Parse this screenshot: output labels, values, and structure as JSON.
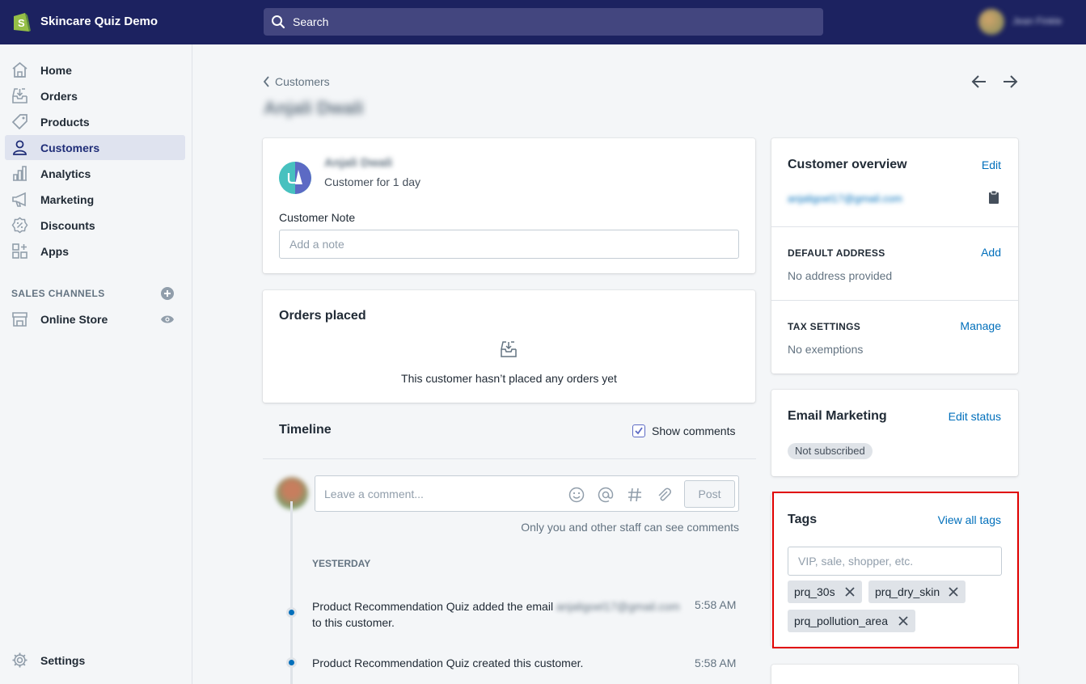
{
  "topbar": {
    "store_name": "Skincare Quiz Demo",
    "search_placeholder": "Search",
    "user_name": "Jean Finkle"
  },
  "sidebar": {
    "items": [
      {
        "label": "Home",
        "icon": "home-icon"
      },
      {
        "label": "Orders",
        "icon": "orders-icon"
      },
      {
        "label": "Products",
        "icon": "tag-icon"
      },
      {
        "label": "Customers",
        "icon": "person-icon",
        "active": true
      },
      {
        "label": "Analytics",
        "icon": "bar-chart-icon"
      },
      {
        "label": "Marketing",
        "icon": "megaphone-icon"
      },
      {
        "label": "Discounts",
        "icon": "discount-icon"
      },
      {
        "label": "Apps",
        "icon": "apps-icon"
      }
    ],
    "sales_channels_title": "SALES CHANNELS",
    "online_store": "Online Store",
    "settings": "Settings"
  },
  "breadcrumb": {
    "back_label": "Customers"
  },
  "page_title": "Anjali Dwali",
  "customer_card": {
    "name": "Anjali Dwali",
    "since": "Customer for 1 day",
    "note_label": "Customer Note",
    "note_placeholder": "Add a note"
  },
  "orders": {
    "title": "Orders placed",
    "empty_text": "This customer hasn’t placed any orders yet"
  },
  "timeline": {
    "title": "Timeline",
    "show_comments_label": "Show comments",
    "show_comments_checked": true,
    "comment_placeholder": "Leave a comment...",
    "post_label": "Post",
    "staff_note": "Only you and other staff can see comments",
    "day_label": "YESTERDAY",
    "events": [
      {
        "text_before": "Product Recommendation Quiz added the email",
        "email": "anjaligoel17@gmail.com",
        "text_after": "to this customer.",
        "time": "5:58 AM"
      },
      {
        "text_before": "Product Recommendation Quiz created this customer.",
        "time": "5:58 AM"
      }
    ]
  },
  "overview": {
    "title": "Customer overview",
    "edit_label": "Edit",
    "email": "anjaligoel17@gmail.com",
    "default_address_title": "DEFAULT ADDRESS",
    "add_label": "Add",
    "no_address": "No address provided",
    "tax_title": "TAX SETTINGS",
    "manage_label": "Manage",
    "no_exemptions": "No exemptions"
  },
  "email_marketing": {
    "title": "Email Marketing",
    "edit_status_label": "Edit status",
    "status_badge": "Not subscribed"
  },
  "tags": {
    "title": "Tags",
    "view_all_label": "View all tags",
    "input_placeholder": "VIP, sale, shopper, etc.",
    "items": [
      "prq_30s",
      "prq_dry_skin",
      "prq_pollution_area"
    ]
  },
  "colors": {
    "topbar": "#1c2260",
    "link": "#006fbb",
    "highlight": "#e00000",
    "shopify_green": "#95bf47"
  }
}
